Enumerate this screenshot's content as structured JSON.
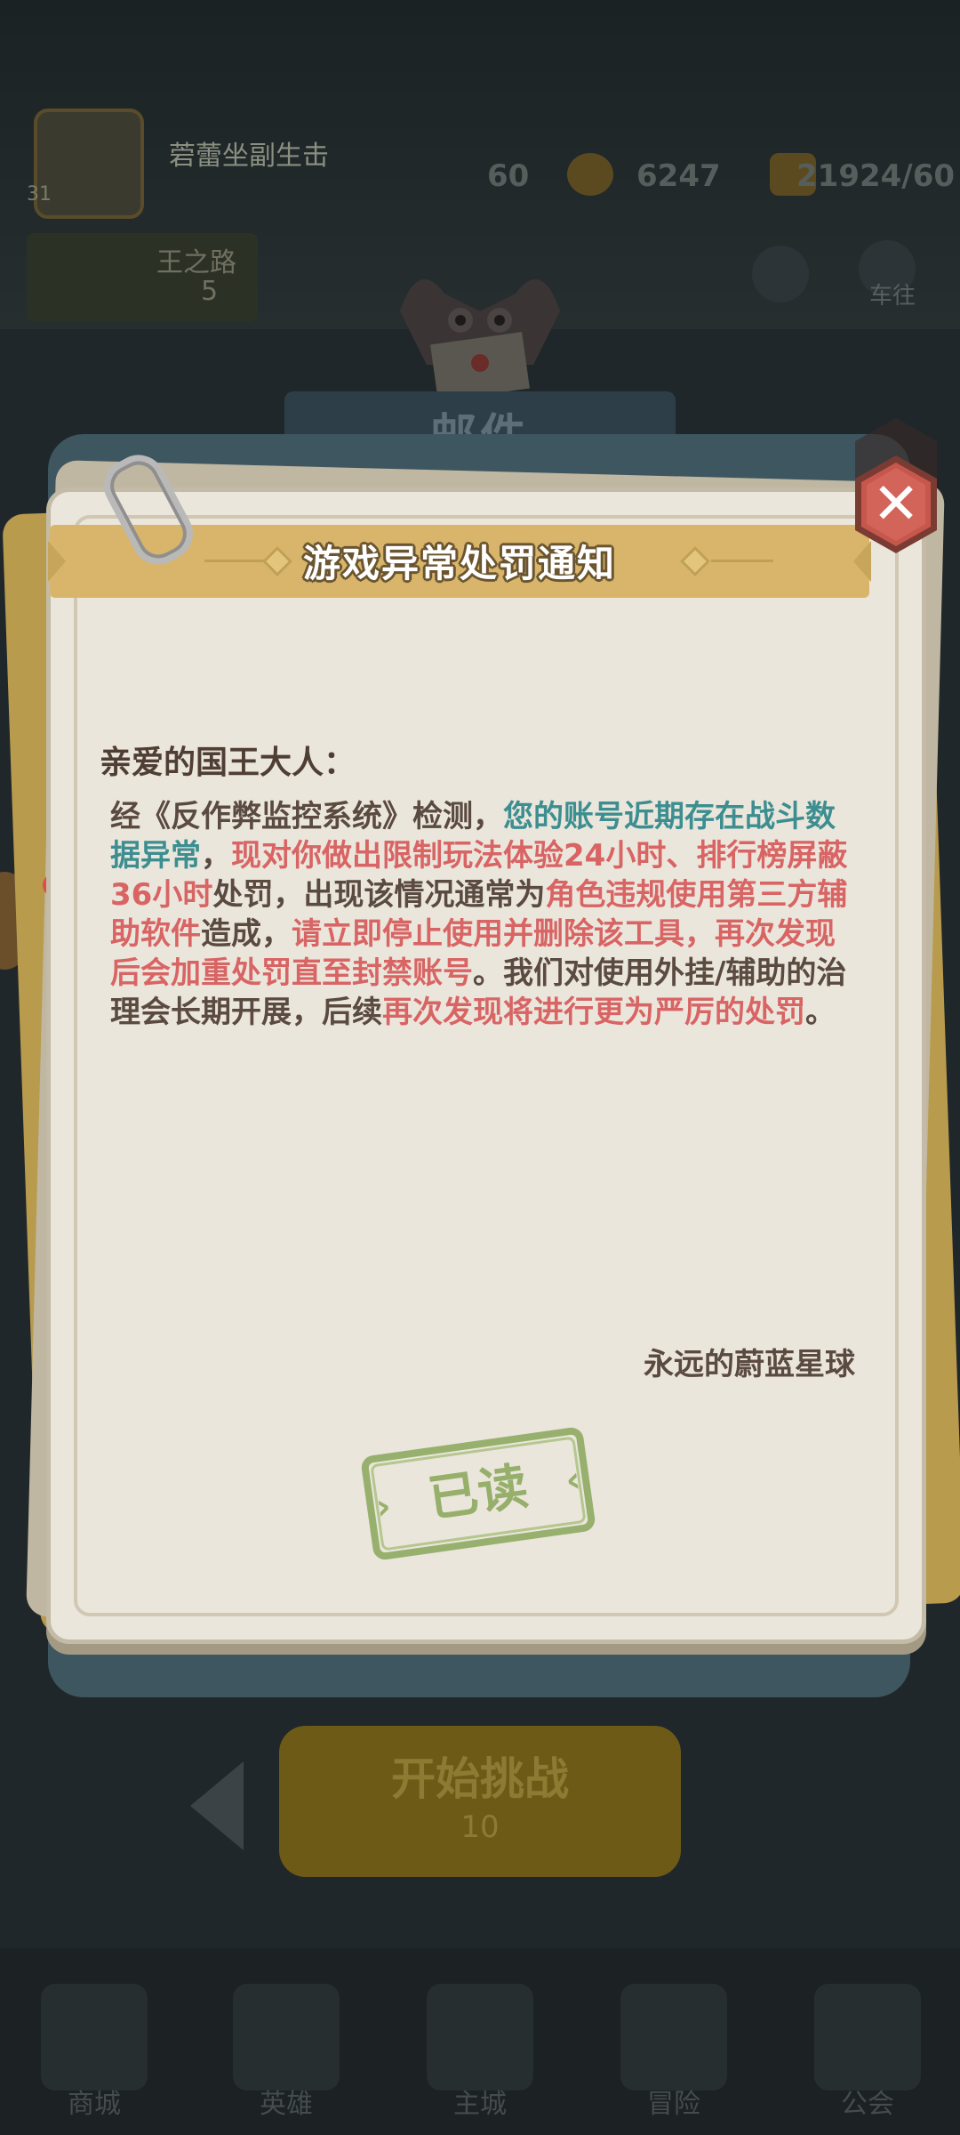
{
  "background": {
    "player_name": "菪蕾坐副生击",
    "level": "31",
    "stamina": "60",
    "gold": "6247",
    "energy": "21924/60",
    "banner_text": "王之路",
    "banner_sub": "5",
    "right_icon_labels": [
      "",
      "车往"
    ],
    "mail_title": "邮件",
    "start_button": "开始挑战",
    "start_cost": "10",
    "nav_labels": [
      "商城",
      "英雄",
      "主城",
      "冒险",
      "公会"
    ]
  },
  "notice": {
    "title": "游戏异常处罚通知",
    "greeting": "亲爱的国王大人：",
    "body": [
      {
        "text": "经《反作弊监控系统》检测，",
        "style": "normal"
      },
      {
        "text": "您的账号近期存在战斗数据异常",
        "style": "teal"
      },
      {
        "text": "，",
        "style": "normal"
      },
      {
        "text": "现对你做出限制玩法体验24小时、排行榜屏蔽36小时",
        "style": "red"
      },
      {
        "text": "处罚，出现该情况通常为",
        "style": "normal"
      },
      {
        "text": "角色违规使用第三方辅助软件",
        "style": "red"
      },
      {
        "text": "造成，",
        "style": "normal"
      },
      {
        "text": "请立即停止使用并删除该工具，再次发现后会加重处罚直至封禁账号",
        "style": "red"
      },
      {
        "text": "。我们对使用外挂/辅助的治理会长期开展，后续",
        "style": "normal"
      },
      {
        "text": "再次发现将进行更为严厉的处罚",
        "style": "red"
      },
      {
        "text": "。",
        "style": "normal"
      }
    ],
    "signature": "永远的蔚蓝星球",
    "read_button": "已读"
  },
  "colors": {
    "teal": "#3d8e90",
    "red": "#d86464",
    "paper": "#ebe6dc",
    "title_banner": "#d8b56a",
    "close_button": "#c7574d",
    "read_stamp": "#96af6b"
  }
}
